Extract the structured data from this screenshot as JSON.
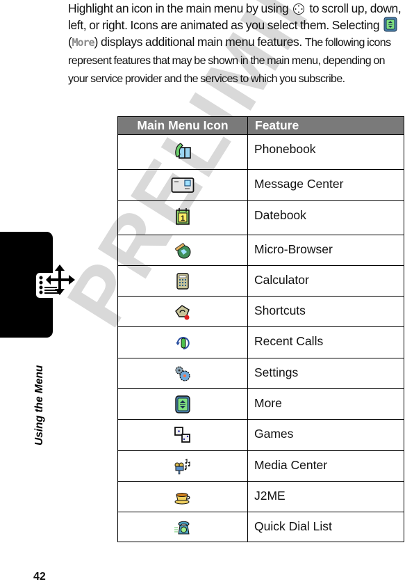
{
  "watermark": "PRELIMINARY",
  "section_tab": {
    "label": "Using the Menu",
    "icon": "menu-navigation-icon"
  },
  "intro": {
    "line1_a": "Highlight an icon in the main menu by using",
    "nav_key_icon": "navigation-key-icon",
    "line1_b": "to scroll up, down, left, or right. Icons are animated as you select them. Selecting",
    "more_icon": "more-icon",
    "more_code": "More",
    "line3": "displays additional main menu features.",
    "line4": "The following icons represent features that may be shown in the main menu, depending on your service provider and the services to which you subscribe."
  },
  "table": {
    "headers": [
      "Main Menu Icon",
      "Feature"
    ],
    "header_bg": "#7a7a7a",
    "rows": [
      {
        "icon": "phonebook-icon",
        "feature": "Phonebook"
      },
      {
        "icon": "message-center-icon",
        "feature": "Message Center"
      },
      {
        "icon": "datebook-icon",
        "feature": "Datebook"
      },
      {
        "icon": "micro-browser-icon",
        "feature": "Micro-Browser"
      },
      {
        "icon": "calculator-icon",
        "feature": "Calculator"
      },
      {
        "icon": "shortcuts-icon",
        "feature": "Shortcuts"
      },
      {
        "icon": "recent-calls-icon",
        "feature": "Recent Calls"
      },
      {
        "icon": "settings-icon",
        "feature": "Settings"
      },
      {
        "icon": "more-icon",
        "feature": "More"
      },
      {
        "icon": "games-icon",
        "feature": "Games"
      },
      {
        "icon": "media-center-icon",
        "feature": "Media Center"
      },
      {
        "icon": "j2me-icon",
        "feature": "J2ME"
      },
      {
        "icon": "quick-dial-list-icon",
        "feature": "Quick Dial List"
      }
    ]
  },
  "page_number": "42"
}
